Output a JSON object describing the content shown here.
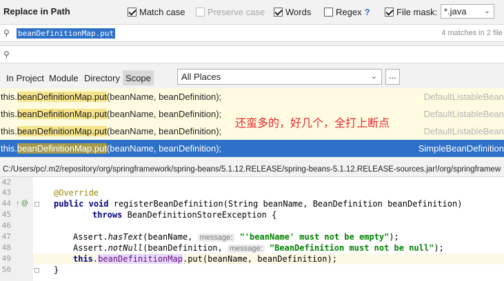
{
  "dialog": {
    "title": "Replace in Path"
  },
  "options": {
    "match_case": {
      "label": "Match case",
      "checked": true
    },
    "preserve_case": {
      "label": "Preserve case",
      "checked": false,
      "disabled": true
    },
    "words": {
      "label": "Words",
      "checked": true
    },
    "regex": {
      "label": "Regex",
      "checked": false,
      "help": "?"
    },
    "file_mask": {
      "label": "File mask:",
      "checked": true,
      "value": "*.java"
    }
  },
  "search": {
    "query": "beanDefinitionMap.put",
    "match_count": "4 matches in 2 file"
  },
  "scope": {
    "tabs": [
      "In Project",
      "Module",
      "Directory",
      "Scope"
    ],
    "selected_tab": "Scope",
    "places": "All Places",
    "more_button": "..."
  },
  "results": [
    {
      "prefix": "this.",
      "match": "beanDefinitionMap.put",
      "suffix": "(beanName, beanDefinition);",
      "file": "DefaultListableBean",
      "selected": false
    },
    {
      "prefix": "this.",
      "match": "beanDefinitionMap.put",
      "suffix": "(beanName, beanDefinition);",
      "file": "DefaultListableBean",
      "selected": false
    },
    {
      "prefix": "this.",
      "match": "beanDefinitionMap.put",
      "suffix": "(beanName, beanDefinition);",
      "file": "DefaultListableBean",
      "selected": false
    },
    {
      "prefix": "this.",
      "match": "beanDefinitionMap.put",
      "suffix": "(beanName, beanDefinition);",
      "file": "SimpleBeanDefinition",
      "selected": true
    }
  ],
  "annotation": "还蛮多的，好几个，全打上断点",
  "path": "C:/Users/pc/.m2/repository/org/springframework/spring-beans/5.1.12.RELEASE/spring-beans-5.1.12.RELEASE-sources.jar!/org/springframew",
  "editor": {
    "line_numbers": [
      "42",
      "43",
      "44",
      "45",
      "46",
      "47",
      "48",
      "49",
      "50"
    ],
    "annotation_text": "@Override",
    "kw_public": "public",
    "kw_void": "void",
    "sig_rest": " registerBeanDefinition(String beanName, BeanDefinition beanDefinition)",
    "kw_throws": "throws",
    "throws_rest": " BeanDefinitionStoreException {",
    "assert1_pre": "Assert.",
    "assert1_method": "hasText",
    "assert1_args": "(beanName, ",
    "assert1_hint": "message:",
    "assert1_str": "\"'beanName' must not be empty\"",
    "assert1_end": ");",
    "assert2_pre": "Assert.",
    "assert2_method": "notNull",
    "assert2_args": "(beanDefinition, ",
    "assert2_hint": "message:",
    "assert2_str": "\"BeanDefinition must not be null\"",
    "assert2_end": ");",
    "line49_this": "this",
    "line49_dot": ".",
    "line49_field": "beanDefinitionMap",
    "line49_rest": ".put(beanName, beanDefinition);",
    "closing_brace": "}",
    "gutter_icons": "↑ @"
  }
}
